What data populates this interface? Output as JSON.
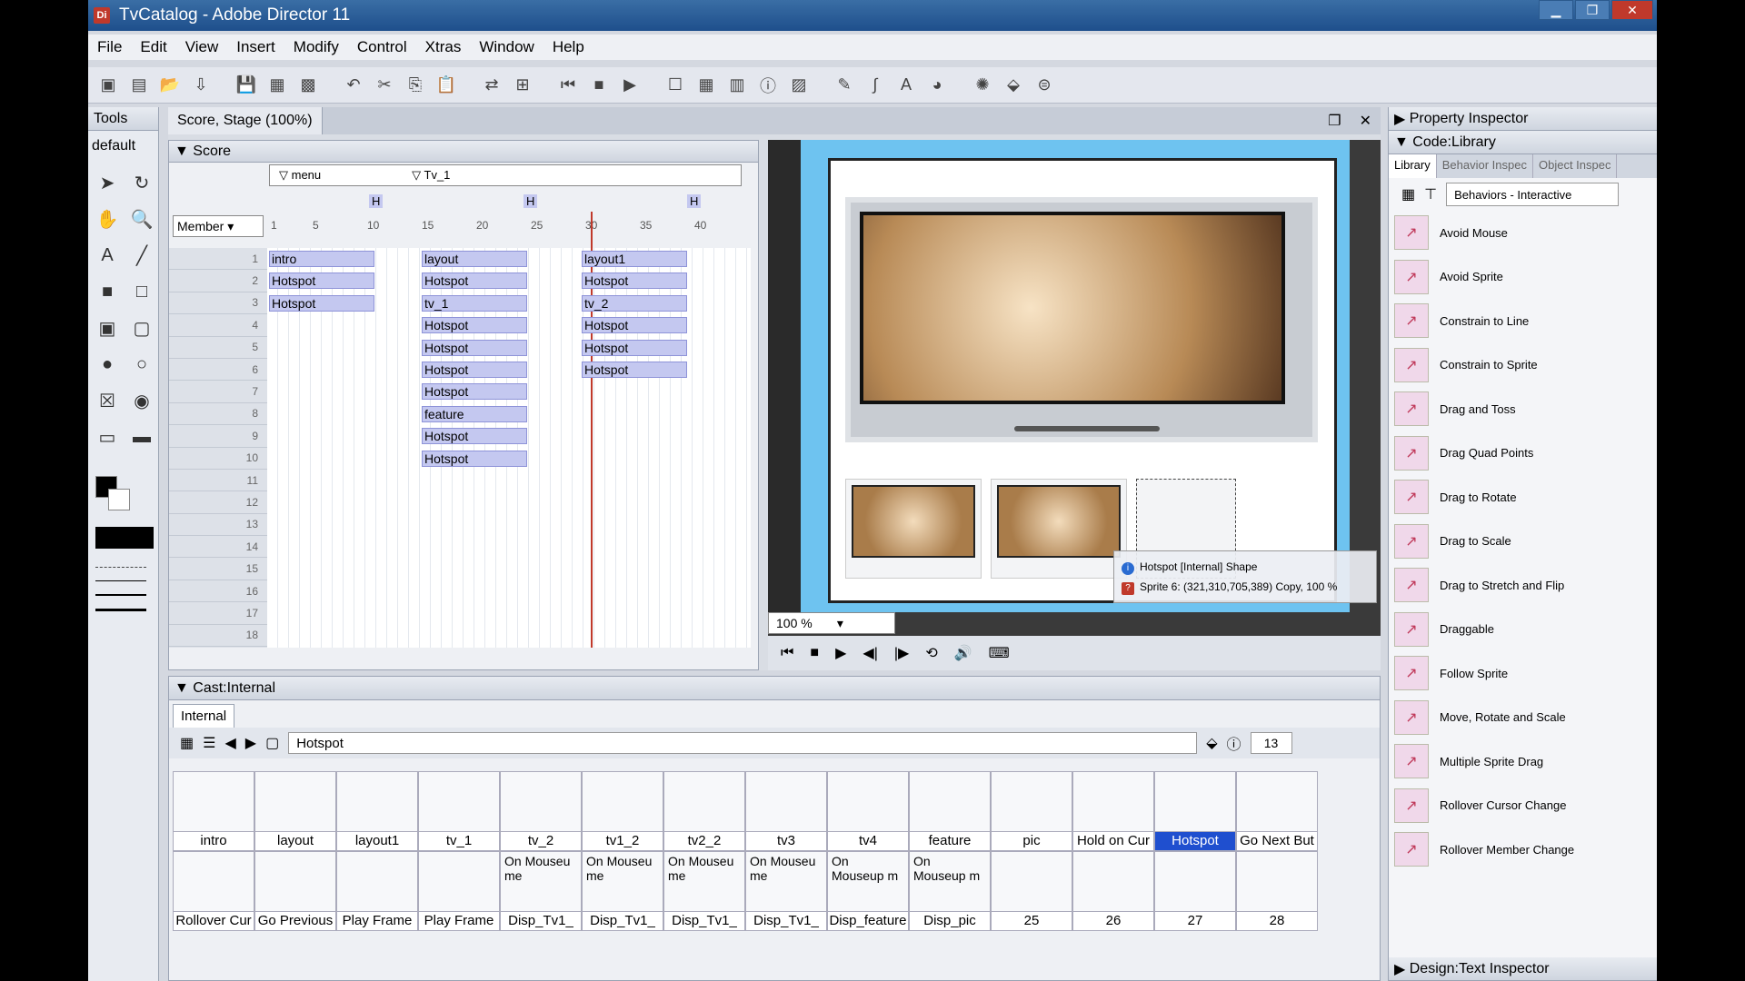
{
  "window": {
    "title": "TvCatalog - Adobe Director 11",
    "app_icon": "Di"
  },
  "menu": [
    "File",
    "Edit",
    "View",
    "Insert",
    "Modify",
    "Control",
    "Xtras",
    "Window",
    "Help"
  ],
  "tools_panel": {
    "title": "Tools",
    "preset": "default"
  },
  "document_tab": "Score, Stage (100%)",
  "score": {
    "title": "Score",
    "markers": [
      "menu",
      "Tv_1"
    ],
    "marker_frames": [
      "H",
      "H",
      "H"
    ],
    "channel_dropdown": "Member",
    "ruler": [
      "1",
      "5",
      "10",
      "15",
      "20",
      "25",
      "30",
      "35",
      "40"
    ],
    "channels": [
      "1",
      "2",
      "3",
      "4",
      "5",
      "6",
      "7",
      "8",
      "9",
      "10",
      "11",
      "12",
      "13",
      "14",
      "15",
      "16",
      "17",
      "18"
    ],
    "sprites_col1": [
      "intro",
      "Hotspot",
      "Hotspot"
    ],
    "sprites_col2": [
      "layout",
      "Hotspot",
      "tv_1",
      "Hotspot",
      "Hotspot",
      "Hotspot",
      "Hotspot",
      "feature",
      "Hotspot",
      "Hotspot"
    ],
    "sprites_col3": [
      "layout1",
      "Hotspot",
      "tv_2",
      "Hotspot",
      "Hotspot",
      "Hotspot"
    ]
  },
  "stage": {
    "zoom": "100 %",
    "tooltip_line1": "Hotspot [Internal] Shape",
    "tooltip_line2": "Sprite 6: (321,310,705,389) Copy, 100 %"
  },
  "cast": {
    "title": "Cast:Internal",
    "tab": "Internal",
    "member_name": "Hotspot",
    "member_number": "13",
    "row1": [
      {
        "label": "intro",
        "thumb": ""
      },
      {
        "label": "layout",
        "thumb": ""
      },
      {
        "label": "layout1",
        "thumb": ""
      },
      {
        "label": "tv_1",
        "thumb": ""
      },
      {
        "label": "tv_2",
        "thumb": ""
      },
      {
        "label": "tv1_2",
        "thumb": ""
      },
      {
        "label": "tv2_2",
        "thumb": ""
      },
      {
        "label": "tv3",
        "thumb": ""
      },
      {
        "label": "tv4",
        "thumb": ""
      },
      {
        "label": "feature",
        "thumb": ""
      },
      {
        "label": "pic",
        "thumb": ""
      },
      {
        "label": "Hold on Cur",
        "thumb": ""
      },
      {
        "label": "Hotspot",
        "thumb": ""
      },
      {
        "label": "Go Next But",
        "thumb": ""
      }
    ],
    "row2": [
      {
        "label": "Rollover Cur",
        "thumb": ""
      },
      {
        "label": "Go Previous",
        "thumb": ""
      },
      {
        "label": "Play Frame",
        "thumb": ""
      },
      {
        "label": "Play Frame",
        "thumb": ""
      },
      {
        "label": "Disp_Tv1_",
        "thumb": "On Mouseu me"
      },
      {
        "label": "Disp_Tv1_",
        "thumb": "On Mouseu me"
      },
      {
        "label": "Disp_Tv1_",
        "thumb": "On Mouseu me"
      },
      {
        "label": "Disp_Tv1_",
        "thumb": "On Mouseu me"
      },
      {
        "label": "Disp_feature",
        "thumb": "On Mouseup m"
      },
      {
        "label": "Disp_pic",
        "thumb": "On Mouseup m"
      },
      {
        "label": "25",
        "thumb": ""
      },
      {
        "label": "26",
        "thumb": ""
      },
      {
        "label": "27",
        "thumb": ""
      },
      {
        "label": "28",
        "thumb": ""
      }
    ]
  },
  "right_panel": {
    "property_inspector": "Property Inspector",
    "code_library": "Code:Library",
    "tabs": [
      "Library",
      "Behavior Inspec",
      "Object Inspec"
    ],
    "category": "Behaviors - Interactive",
    "behaviors": [
      "Avoid Mouse",
      "Avoid Sprite",
      "Constrain to Line",
      "Constrain to Sprite",
      "Drag and Toss",
      "Drag Quad Points",
      "Drag to Rotate",
      "Drag to Scale",
      "Drag to Stretch and Flip",
      "Draggable",
      "Follow Sprite",
      "Move, Rotate and Scale",
      "Multiple Sprite Drag",
      "Rollover Cursor Change",
      "Rollover Member Change"
    ],
    "design_text": "Design:Text Inspector"
  },
  "colors": {
    "titlebar": "#1e4f8c",
    "selection": "#1f4fcf",
    "playhead": "#c0392b"
  }
}
